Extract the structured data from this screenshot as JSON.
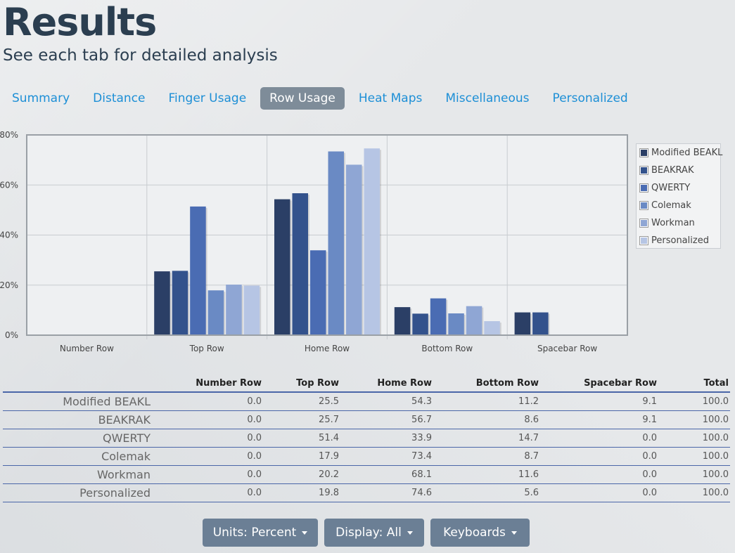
{
  "header": {
    "title": "Results",
    "subtitle": "See each tab for detailed analysis"
  },
  "tabs": [
    {
      "label": "Summary",
      "active": false
    },
    {
      "label": "Distance",
      "active": false
    },
    {
      "label": "Finger Usage",
      "active": false
    },
    {
      "label": "Row Usage",
      "active": true
    },
    {
      "label": "Heat Maps",
      "active": false
    },
    {
      "label": "Miscellaneous",
      "active": false
    },
    {
      "label": "Personalized",
      "active": false
    }
  ],
  "chart_data": {
    "type": "bar",
    "categories": [
      "Number Row",
      "Top Row",
      "Home Row",
      "Bottom Row",
      "Spacebar Row"
    ],
    "yticks": [
      "0%",
      "20%",
      "40%",
      "60%",
      "80%"
    ],
    "ylim": [
      0,
      80
    ],
    "grid": true,
    "legend_position": "right",
    "series": [
      {
        "name": "Modified BEAKL",
        "color": "#2b3f66",
        "values": [
          0.0,
          25.5,
          54.3,
          11.2,
          9.1
        ]
      },
      {
        "name": "BEAKRAK",
        "color": "#33528c",
        "values": [
          0.0,
          25.7,
          56.7,
          8.6,
          9.1
        ]
      },
      {
        "name": "QWERTY",
        "color": "#4a6cb3",
        "values": [
          0.0,
          51.4,
          33.9,
          14.7,
          0.0
        ]
      },
      {
        "name": "Colemak",
        "color": "#6a8ac4",
        "values": [
          0.0,
          17.9,
          73.4,
          8.7,
          0.0
        ]
      },
      {
        "name": "Workman",
        "color": "#8fa6d4",
        "values": [
          0.0,
          20.2,
          68.1,
          11.6,
          0.0
        ]
      },
      {
        "name": "Personalized",
        "color": "#b6c5e4",
        "values": [
          0.0,
          19.8,
          74.6,
          5.6,
          0.0
        ]
      }
    ]
  },
  "table": {
    "columns": [
      "Number Row",
      "Top Row",
      "Home Row",
      "Bottom Row",
      "Spacebar Row",
      "Total"
    ],
    "rows": [
      {
        "name": "Modified BEAKL",
        "cells": [
          "0.0",
          "25.5",
          "54.3",
          "11.2",
          "9.1",
          "100.0"
        ]
      },
      {
        "name": "BEAKRAK",
        "cells": [
          "0.0",
          "25.7",
          "56.7",
          "8.6",
          "9.1",
          "100.0"
        ]
      },
      {
        "name": "QWERTY",
        "cells": [
          "0.0",
          "51.4",
          "33.9",
          "14.7",
          "0.0",
          "100.0"
        ]
      },
      {
        "name": "Colemak",
        "cells": [
          "0.0",
          "17.9",
          "73.4",
          "8.7",
          "0.0",
          "100.0"
        ]
      },
      {
        "name": "Workman",
        "cells": [
          "0.0",
          "20.2",
          "68.1",
          "11.6",
          "0.0",
          "100.0"
        ]
      },
      {
        "name": "Personalized",
        "cells": [
          "0.0",
          "19.8",
          "74.6",
          "5.6",
          "0.0",
          "100.0"
        ]
      }
    ]
  },
  "controls": {
    "units_label": "Units: Percent",
    "display_label": "Display: All",
    "keyboards_label": "Keyboards"
  }
}
